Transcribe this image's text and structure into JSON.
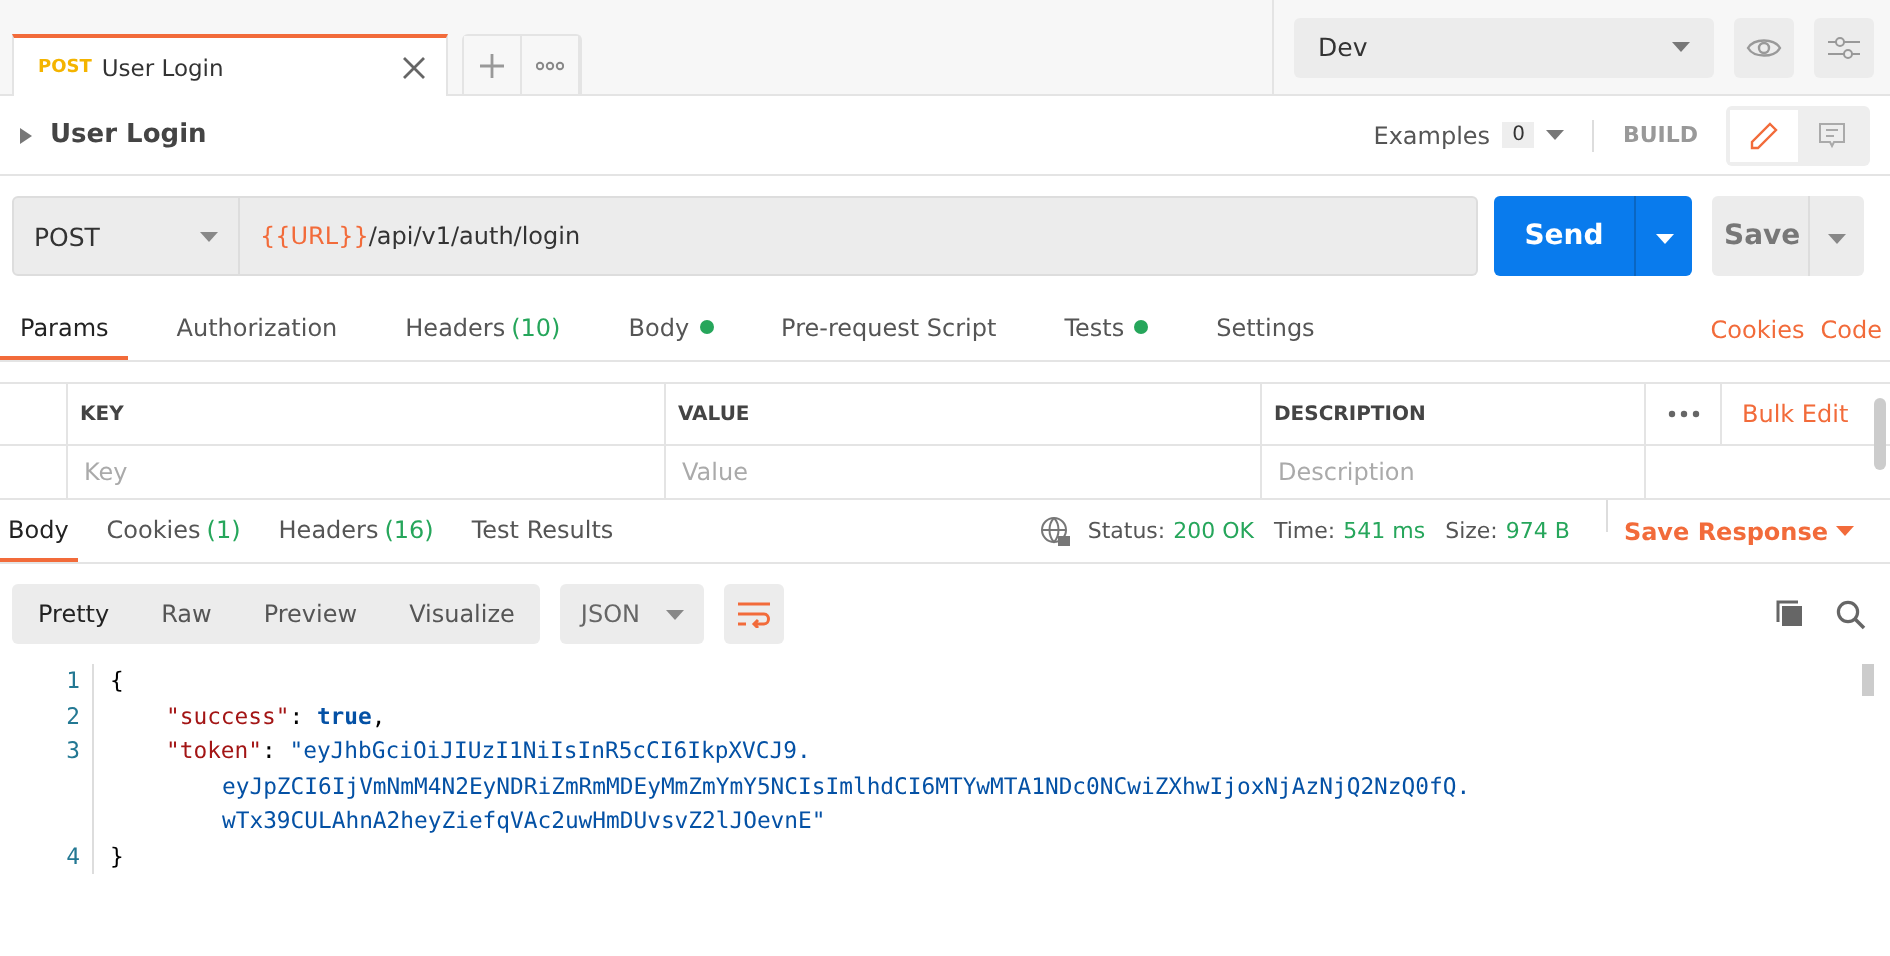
{
  "request_tabs_bar": {
    "tabs": [
      {
        "method": "POST",
        "label": "User Login",
        "selected": true
      }
    ]
  },
  "environment": {
    "value": "Dev"
  },
  "request": {
    "title": "User Login",
    "examples_label": "Examples",
    "examples_count": "0",
    "mode": "BUILD",
    "method": "POST",
    "url_variable": "{{URL}}",
    "url_path": "/api/v1/auth/login",
    "send": "Send",
    "save": "Save"
  },
  "request_tabs": [
    {
      "label": "Params",
      "dot": false,
      "selected": true
    },
    {
      "label": "Authorization",
      "dot": false,
      "selected": false
    },
    {
      "label": "Headers",
      "count": "(10)",
      "dot": false,
      "selected": false
    },
    {
      "label": "Body",
      "dot": true,
      "selected": false
    },
    {
      "label": "Pre-request Script",
      "dot": false,
      "selected": false
    },
    {
      "label": "Tests",
      "dot": true,
      "selected": false
    },
    {
      "label": "Settings",
      "dot": false,
      "selected": false
    }
  ],
  "request_links": [
    "Cookies",
    "Code"
  ],
  "params_table": {
    "columns": [
      "KEY",
      "VALUE",
      "DESCRIPTION"
    ],
    "bulk_edit": "Bulk Edit",
    "placeholders": [
      "Key",
      "Value",
      "Description"
    ]
  },
  "response_tabs": [
    {
      "label": "Body",
      "selected": true
    },
    {
      "label": "Cookies",
      "count": "(1)",
      "selected": false
    },
    {
      "label": "Headers",
      "count": "(16)",
      "selected": false
    },
    {
      "label": "Test Results",
      "selected": false
    }
  ],
  "response_meta": [
    {
      "label": "Status:",
      "value": "200 OK"
    },
    {
      "label": "Time:",
      "value": "541 ms"
    },
    {
      "label": "Size:",
      "value": "974 B"
    }
  ],
  "save_response": "Save Response",
  "view_modes": [
    {
      "label": "Pretty",
      "selected": true
    },
    {
      "label": "Raw",
      "selected": false
    },
    {
      "label": "Preview",
      "selected": false
    },
    {
      "label": "Visualize",
      "selected": false
    }
  ],
  "format": "JSON",
  "code_lines": [
    {
      "number": "1",
      "parts": [
        {
          "kind": "punct",
          "text": "{"
        }
      ]
    },
    {
      "number": "2",
      "indent": true,
      "parts": [
        {
          "kind": "key",
          "text": "\"success\""
        },
        {
          "kind": "punct",
          "text": ": "
        },
        {
          "kind": "bool",
          "text": "true"
        },
        {
          "kind": "punct",
          "text": ","
        }
      ]
    },
    {
      "number": "3",
      "indent": true,
      "parts": [
        {
          "kind": "key",
          "text": "\"token\""
        },
        {
          "kind": "punct",
          "text": ": "
        },
        {
          "kind": "string",
          "text": "\"eyJhbGciOiJIUzI1NiIsInR5cCI6IkpXVCJ9."
        }
      ]
    },
    {
      "wrap": true,
      "parts": [
        {
          "kind": "string",
          "text": "eyJpZCI6IjVmNmM4N2EyNDRiZmRmMDEyMmZmYmY5NCIsImlhdCI6MTYwMTA1NDc0NCwiZXhwIjoxNjAzNjQ2NzQ0fQ."
        }
      ]
    },
    {
      "wrap": true,
      "parts": [
        {
          "kind": "string",
          "text": "wTx39CULAhnA2heyZiefqVAc2uwHmDUvsvZ2lJOevnE\""
        }
      ]
    },
    {
      "number": "4",
      "parts": [
        {
          "kind": "punct",
          "text": "}"
        }
      ]
    }
  ]
}
